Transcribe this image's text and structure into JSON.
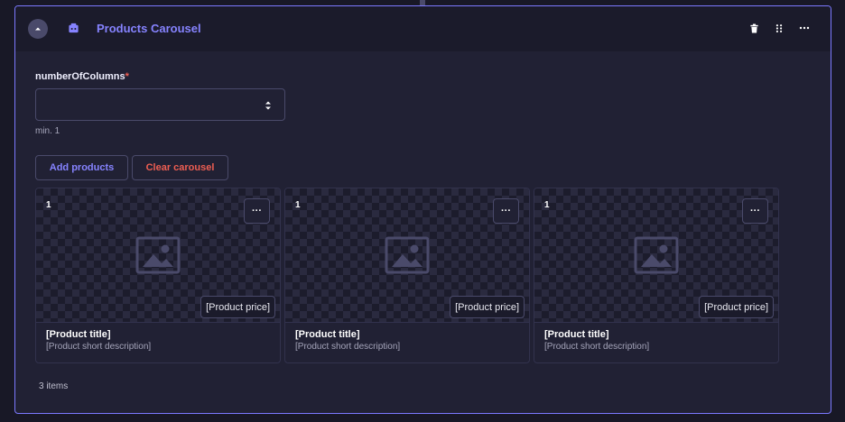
{
  "panel": {
    "title": "Products Carousel",
    "icons": {
      "collapse": "chevron-up-icon",
      "component": "carousel-icon",
      "delete": "trash-icon",
      "drag": "drag-handle-icon",
      "more": "more-horizontal-icon"
    }
  },
  "field": {
    "label": "numberOfColumns",
    "required_mark": "*",
    "value": "",
    "hint": "min. 1"
  },
  "buttons": {
    "add": "Add products",
    "clear": "Clear carousel"
  },
  "products": [
    {
      "index": "1",
      "menu": "···",
      "price": "[Product price]",
      "title": "[Product title]",
      "description": "[Product short description]"
    },
    {
      "index": "1",
      "menu": "···",
      "price": "[Product price]",
      "title": "[Product title]",
      "description": "[Product short description]"
    },
    {
      "index": "1",
      "menu": "···",
      "price": "[Product price]",
      "title": "[Product title]",
      "description": "[Product short description]"
    }
  ],
  "footer": {
    "count": "3 items"
  },
  "colors": {
    "accent": "#7b79ff",
    "danger": "#ee5e52",
    "background": "#181826",
    "panel": "#212134"
  }
}
